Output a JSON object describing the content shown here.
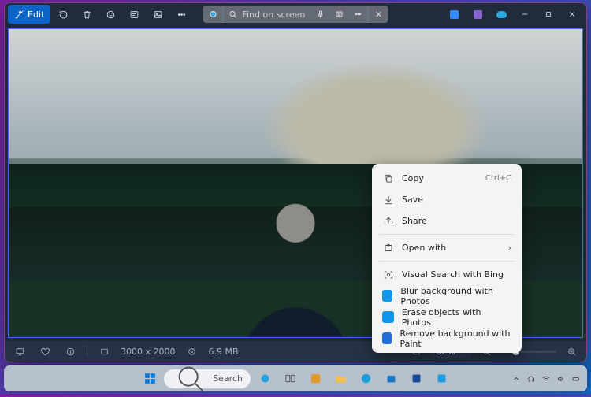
{
  "titlebar": {
    "edit_label": "Edit"
  },
  "search_pill": {
    "placeholder": "Find on screen"
  },
  "status": {
    "dimensions": "3000 x 2000",
    "file_size": "6.9 MB",
    "zoom": "62%"
  },
  "context_menu": {
    "items": [
      {
        "label": "Copy",
        "shortcut": "Ctrl+C",
        "icon": "copy"
      },
      {
        "label": "Save",
        "icon": "save"
      },
      {
        "label": "Share",
        "icon": "share"
      },
      {
        "sep": true
      },
      {
        "label": "Open with",
        "icon": "open",
        "submenu": true
      },
      {
        "sep": true
      },
      {
        "label": "Visual Search with Bing",
        "icon": "visual"
      },
      {
        "label": "Blur background with Photos",
        "icon": "app-photos"
      },
      {
        "label": "Erase objects with Photos",
        "icon": "app-photos"
      },
      {
        "label": "Remove background with Paint",
        "icon": "app-paint"
      }
    ]
  },
  "taskbar": {
    "search_placeholder": "Search"
  }
}
